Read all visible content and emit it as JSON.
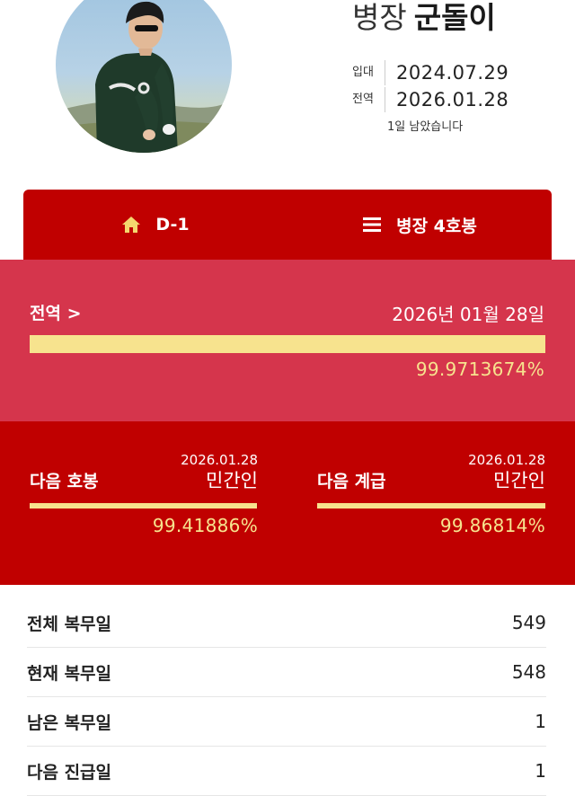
{
  "profile": {
    "rank": "병장",
    "nickname": "군돌이",
    "enlist_label": "입대",
    "enlist_date": "2024.07.29",
    "discharge_label": "전역",
    "discharge_date": "2026.01.28",
    "remaining_text": "1일 남았습니다"
  },
  "tabs": [
    {
      "label": "D-1",
      "icon": "home-icon"
    },
    {
      "label": "병장 4호봉",
      "icon": "menu-icon"
    }
  ],
  "discharge": {
    "title": "전역 >",
    "date": "2026년 01월 28일",
    "percent_text": "99.9713674%",
    "progress": 0.999713674
  },
  "next_pay_step": {
    "title": "다음 호봉",
    "date": "2026.01.28",
    "name": "민간인",
    "percent_text": "99.41886%",
    "progress": 0.9941886
  },
  "next_rank": {
    "title": "다음 계급",
    "date": "2026.01.28",
    "name": "민간인",
    "percent_text": "99.86814%",
    "progress": 0.9986814
  },
  "stats": [
    {
      "label": "전체 복무일",
      "value": "549"
    },
    {
      "label": "현재 복무일",
      "value": "548"
    },
    {
      "label": "남은 복무일",
      "value": "1"
    },
    {
      "label": "다음 진급일",
      "value": "1"
    }
  ],
  "colors": {
    "primary": "#c00000",
    "secondary": "#d5354c",
    "accent": "#f7e38e",
    "tab_icon": "#f5d76e"
  }
}
